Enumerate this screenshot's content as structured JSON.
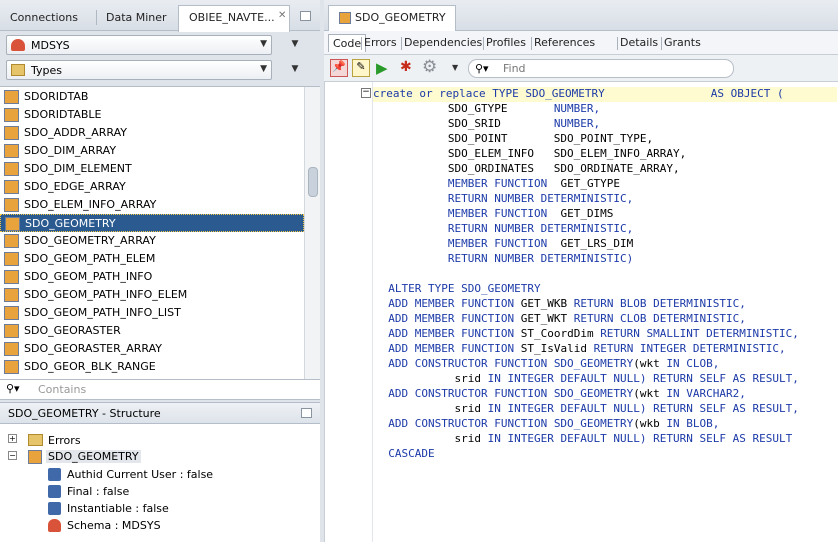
{
  "left_tabs": [
    "Connections",
    "Data Miner",
    "OBIEE_NAVTE..."
  ],
  "editor_tab": "SDO_GEOMETRY",
  "schema_combo": "MDSYS",
  "type_combo": "Types",
  "type_list": [
    "SDORIDTAB",
    "SDORIDTABLE",
    "SDO_ADDR_ARRAY",
    "SDO_DIM_ARRAY",
    "SDO_DIM_ELEMENT",
    "SDO_EDGE_ARRAY",
    "SDO_ELEM_INFO_ARRAY",
    "SDO_GEOMETRY",
    "SDO_GEOMETRY_ARRAY",
    "SDO_GEOM_PATH_ELEM",
    "SDO_GEOM_PATH_INFO",
    "SDO_GEOM_PATH_INFO_ELEM",
    "SDO_GEOM_PATH_INFO_LIST",
    "SDO_GEORASTER",
    "SDO_GEORASTER_ARRAY",
    "SDO_GEOR_BLK_RANGE"
  ],
  "selected_type": "SDO_GEOMETRY",
  "filter_placeholder": "Contains",
  "structure": {
    "title": "SDO_GEOMETRY - Structure",
    "errors": "Errors",
    "node": "SDO_GEOMETRY",
    "props": [
      "Authid Current User : false",
      "Final : false",
      "Instantiable : false",
      "Schema : MDSYS"
    ]
  },
  "sub_tabs": [
    "Code",
    "Errors",
    "Dependencies",
    "Profiles",
    "References",
    "Details",
    "Grants"
  ],
  "find_placeholder": "Find",
  "code_lines": [
    [
      [
        "k",
        "create or replace TYPE SDO_GEOMETRY"
      ],
      [
        "t",
        "                "
      ],
      [
        "k",
        "AS OBJECT ("
      ]
    ],
    [
      [
        "t",
        "           SDO_GTYPE       "
      ],
      [
        "k",
        "NUMBER,"
      ]
    ],
    [
      [
        "t",
        "           SDO_SRID        "
      ],
      [
        "k",
        "NUMBER,"
      ]
    ],
    [
      [
        "t",
        "           SDO_POINT       SDO_POINT_TYPE,"
      ]
    ],
    [
      [
        "t",
        "           SDO_ELEM_INFO   SDO_ELEM_INFO_ARRAY,"
      ]
    ],
    [
      [
        "t",
        "           SDO_ORDINATES   SDO_ORDINATE_ARRAY,"
      ]
    ],
    [
      [
        "t",
        "           "
      ],
      [
        "k",
        "MEMBER FUNCTION"
      ],
      [
        "t",
        "  GET_GTYPE"
      ]
    ],
    [
      [
        "t",
        "           "
      ],
      [
        "k",
        "RETURN NUMBER DETERMINISTIC,"
      ]
    ],
    [
      [
        "t",
        "           "
      ],
      [
        "k",
        "MEMBER FUNCTION"
      ],
      [
        "t",
        "  GET_DIMS"
      ]
    ],
    [
      [
        "t",
        "           "
      ],
      [
        "k",
        "RETURN NUMBER DETERMINISTIC,"
      ]
    ],
    [
      [
        "t",
        "           "
      ],
      [
        "k",
        "MEMBER FUNCTION"
      ],
      [
        "t",
        "  GET_LRS_DIM"
      ]
    ],
    [
      [
        "t",
        "           "
      ],
      [
        "k",
        "RETURN NUMBER DETERMINISTIC)"
      ]
    ],
    [
      [
        "t",
        ""
      ]
    ],
    [
      [
        "t",
        "  "
      ],
      [
        "k",
        "ALTER TYPE SDO_GEOMETRY"
      ]
    ],
    [
      [
        "t",
        "  "
      ],
      [
        "k",
        "ADD MEMBER FUNCTION"
      ],
      [
        "t",
        " GET_WKB "
      ],
      [
        "k",
        "RETURN BLOB DETERMINISTIC,"
      ]
    ],
    [
      [
        "t",
        "  "
      ],
      [
        "k",
        "ADD MEMBER FUNCTION"
      ],
      [
        "t",
        " GET_WKT "
      ],
      [
        "k",
        "RETURN CLOB DETERMINISTIC,"
      ]
    ],
    [
      [
        "t",
        "  "
      ],
      [
        "k",
        "ADD MEMBER FUNCTION"
      ],
      [
        "t",
        " ST_CoordDim "
      ],
      [
        "k",
        "RETURN SMALLINT DETERMINISTIC,"
      ]
    ],
    [
      [
        "t",
        "  "
      ],
      [
        "k",
        "ADD MEMBER FUNCTION"
      ],
      [
        "t",
        " ST_IsValid "
      ],
      [
        "k",
        "RETURN INTEGER DETERMINISTIC,"
      ]
    ],
    [
      [
        "t",
        "  "
      ],
      [
        "k",
        "ADD CONSTRUCTOR FUNCTION SDO_GEOMETRY"
      ],
      [
        "t",
        "(wkt "
      ],
      [
        "k",
        "IN CLOB,"
      ]
    ],
    [
      [
        "t",
        "            srid "
      ],
      [
        "k",
        "IN INTEGER DEFAULT NULL) RETURN SELF AS RESULT,"
      ]
    ],
    [
      [
        "t",
        "  "
      ],
      [
        "k",
        "ADD CONSTRUCTOR FUNCTION SDO_GEOMETRY"
      ],
      [
        "t",
        "(wkt "
      ],
      [
        "k",
        "IN VARCHAR2,"
      ]
    ],
    [
      [
        "t",
        "            srid "
      ],
      [
        "k",
        "IN INTEGER DEFAULT NULL) RETURN SELF AS RESULT,"
      ]
    ],
    [
      [
        "t",
        "  "
      ],
      [
        "k",
        "ADD CONSTRUCTOR FUNCTION SDO_GEOMETRY"
      ],
      [
        "t",
        "(wkb "
      ],
      [
        "k",
        "IN BLOB,"
      ]
    ],
    [
      [
        "t",
        "            srid "
      ],
      [
        "k",
        "IN INTEGER DEFAULT NULL) RETURN SELF AS RESULT"
      ]
    ],
    [
      [
        "t",
        "  "
      ],
      [
        "k",
        "CASCADE"
      ]
    ]
  ]
}
